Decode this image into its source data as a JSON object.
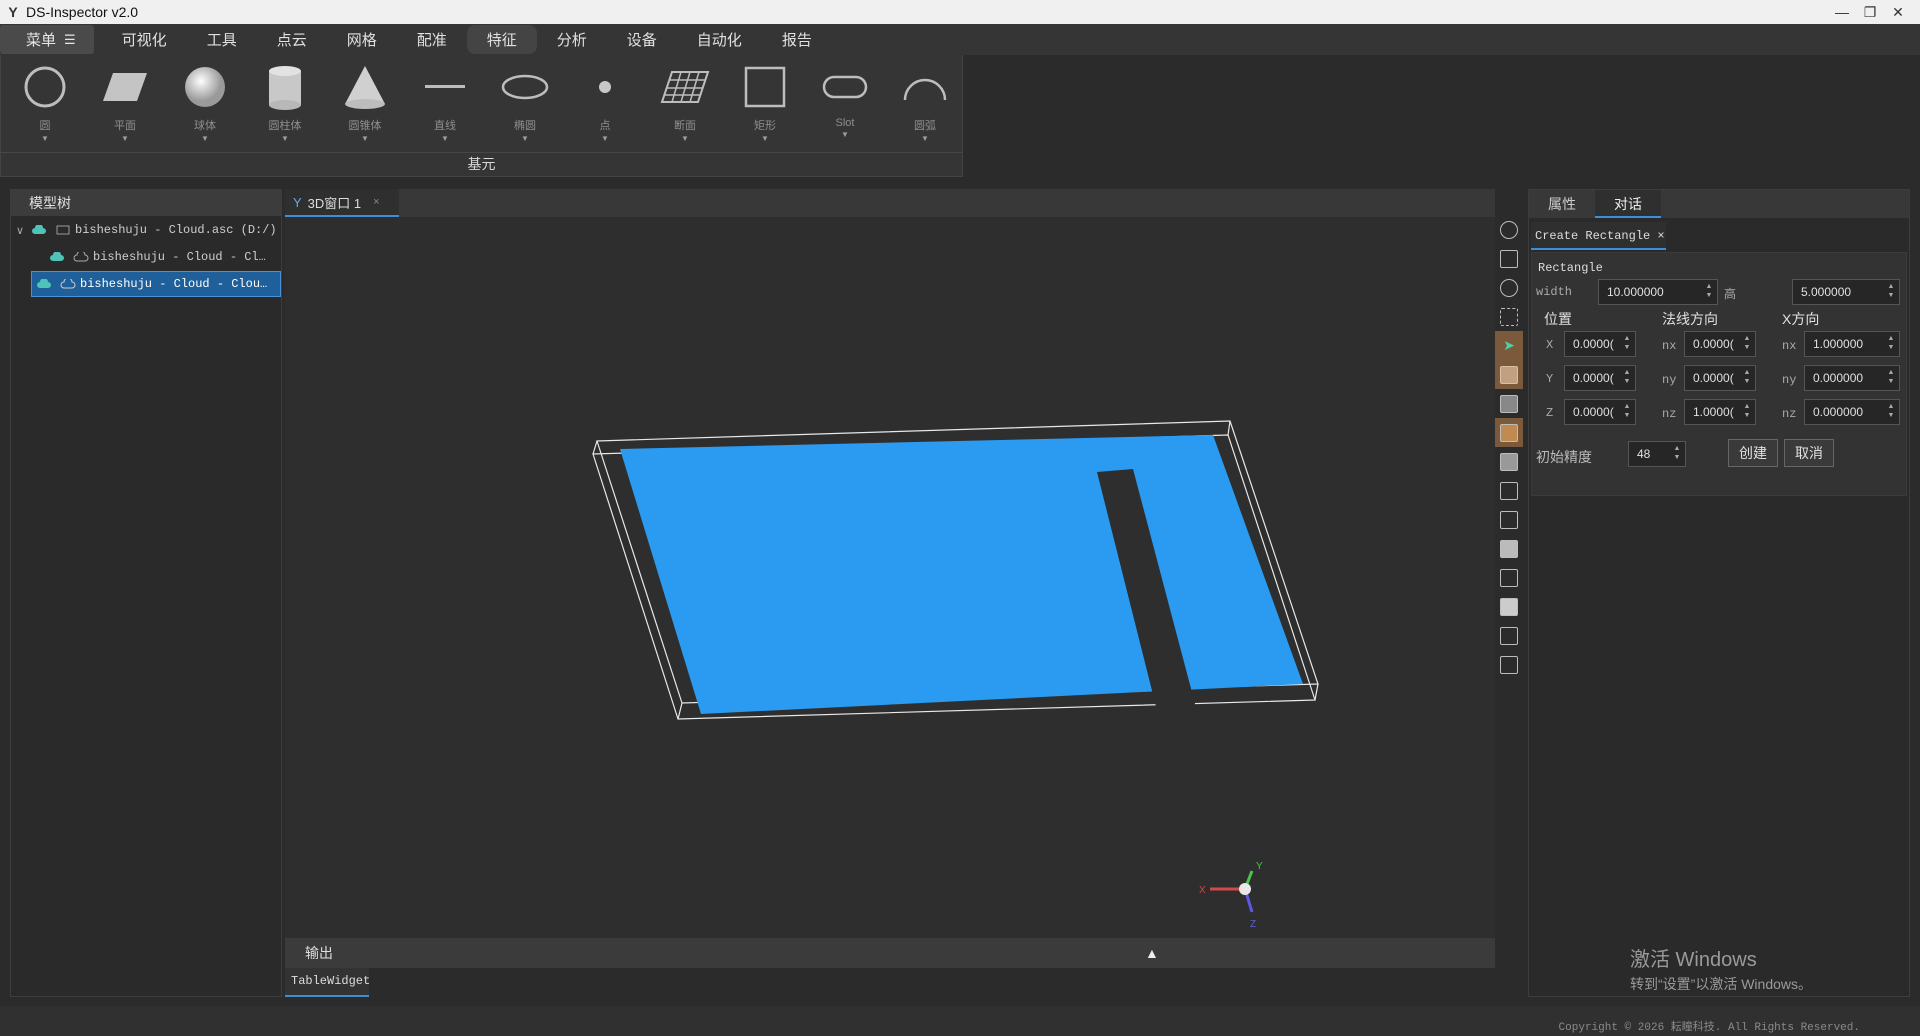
{
  "window": {
    "title": "DS-Inspector v2.0",
    "logo": "Y"
  },
  "menubar": {
    "main": "菜单",
    "items": [
      "可视化",
      "工具",
      "点云",
      "网格",
      "配准",
      "特征",
      "分析",
      "设备",
      "自动化",
      "报告"
    ],
    "active_index": 5
  },
  "ribbon": {
    "tools": [
      {
        "label": "圆",
        "icon": "circle-icon"
      },
      {
        "label": "平面",
        "icon": "plane-icon"
      },
      {
        "label": "球体",
        "icon": "sphere-icon"
      },
      {
        "label": "圆柱体",
        "icon": "cylinder-icon"
      },
      {
        "label": "圆锥体",
        "icon": "cone-icon"
      },
      {
        "label": "直线",
        "icon": "line-icon"
      },
      {
        "label": "椭圆",
        "icon": "ellipse-icon"
      },
      {
        "label": "点",
        "icon": "point-icon"
      },
      {
        "label": "断面",
        "icon": "section-icon"
      },
      {
        "label": "矩形",
        "icon": "rectangle-icon"
      },
      {
        "label": "Slot",
        "icon": "slot-icon"
      },
      {
        "label": "圆弧",
        "icon": "arc-icon"
      }
    ],
    "group_label": "基元"
  },
  "model_tree": {
    "header": "模型树",
    "items": [
      {
        "text": "bisheshuju - Cloud.asc (D:/)",
        "level": 0
      },
      {
        "text": "bisheshuju - Cloud - Cl…",
        "level": 1
      },
      {
        "text": "bisheshuju - Cloud - Clou…",
        "level": 0,
        "selected": true
      }
    ]
  },
  "viewport": {
    "tab_label": "3D窗口 1",
    "tab_close": "×",
    "axis": {
      "x": "X",
      "y": "Y",
      "z": "Z"
    },
    "cloud_color": "#2a9bf0"
  },
  "output": {
    "label": "输出",
    "toggle": "▲",
    "table_tab": "TableWidget"
  },
  "right_panel": {
    "tabs": [
      "属性",
      "对话"
    ],
    "active_tab": 1,
    "dialog_tab": "Create Rectangle",
    "dialog_close": "×",
    "section_title": "Rectangle",
    "width_label": "width",
    "width_value": "10.000000",
    "height_label": "高",
    "height_value": "5.000000",
    "position_header": "位置",
    "normal_header": "法线方向",
    "xdir_header": "X方向",
    "rows": [
      {
        "pos_label": "X",
        "pos_value": "0.0000(",
        "n_label": "nx",
        "n_value": "0.0000(",
        "x_label": "nx",
        "x_value": "1.000000"
      },
      {
        "pos_label": "Y",
        "pos_value": "0.0000(",
        "n_label": "ny",
        "n_value": "0.0000(",
        "x_label": "ny",
        "x_value": "0.000000"
      },
      {
        "pos_label": "Z",
        "pos_value": "0.0000(",
        "n_label": "nz",
        "n_value": "1.0000(",
        "x_label": "nz",
        "x_value": "0.000000"
      }
    ],
    "precision_label": "初始精度",
    "precision_value": "48",
    "create_label": "创建",
    "cancel_label": "取消"
  },
  "watermark": {
    "line1": "激活 Windows",
    "line2": "转到“设置”以激活 Windows。"
  },
  "statusbar": {
    "copyright": "Copyright © 2026 耘瞳科技. All Rights Reserved."
  }
}
